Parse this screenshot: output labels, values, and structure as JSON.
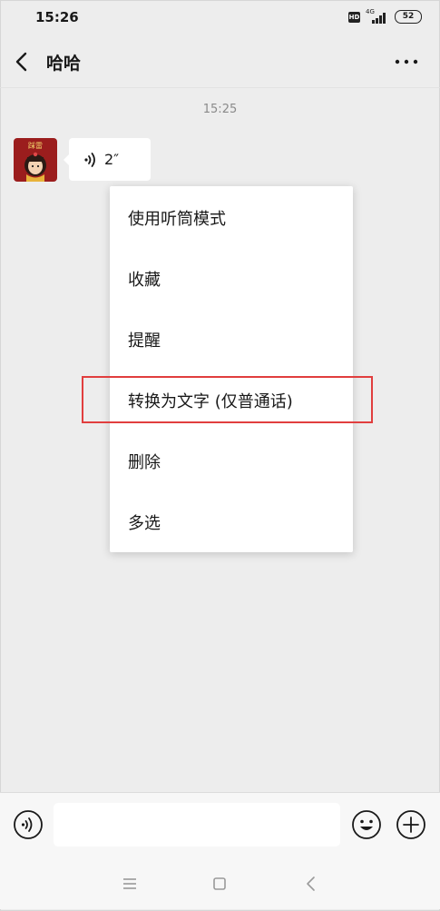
{
  "status_bar": {
    "time": "15:26",
    "hd_label": "HD",
    "network_label": "4G",
    "battery_level": "52"
  },
  "header": {
    "title": "哈哈"
  },
  "chat": {
    "timestamp": "15:25",
    "voice_message": {
      "duration": "2″"
    },
    "avatar_text": "踩雷"
  },
  "context_menu": {
    "items": [
      {
        "label": "使用听筒模式"
      },
      {
        "label": "收藏"
      },
      {
        "label": "提醒"
      },
      {
        "label": "转换为文字 (仅普通话)"
      },
      {
        "label": "删除"
      },
      {
        "label": "多选"
      }
    ],
    "highlight_color": "#e13e3e"
  },
  "input_bar": {
    "placeholder": ""
  },
  "colors": {
    "background": "#ededed",
    "bubble": "#ffffff",
    "avatar_bg": "#9b1d1d"
  }
}
